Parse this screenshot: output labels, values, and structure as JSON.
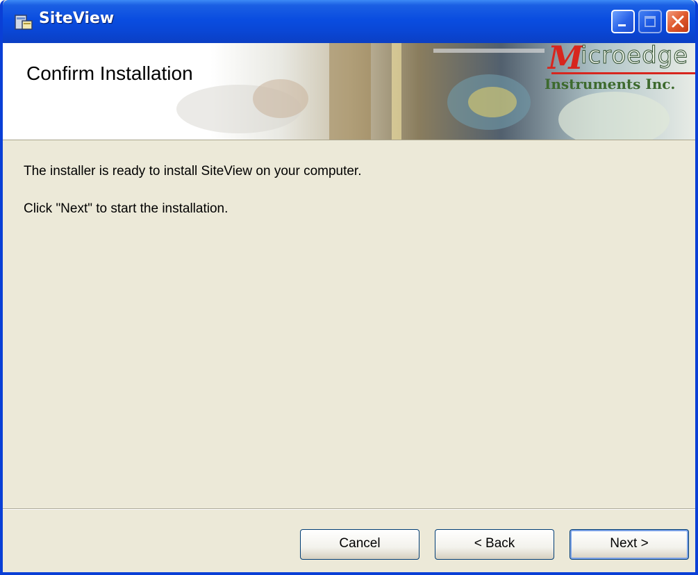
{
  "window": {
    "title": "SiteView",
    "minimize_icon": "minimize-icon",
    "maximize_icon": "maximize-icon",
    "close_icon": "close-icon",
    "app_icon": "installer-icon"
  },
  "banner": {
    "title": "Confirm Installation",
    "logo": {
      "initial": "M",
      "text": "icroedge",
      "subtext": "Instruments Inc.",
      "accent_color": "#d7261e"
    }
  },
  "content": {
    "lines": [
      "The installer is ready to install SiteView on your computer.",
      "Click \"Next\" to start the installation."
    ]
  },
  "buttons": {
    "cancel": "Cancel",
    "back": "< Back",
    "next": "Next >"
  },
  "colors": {
    "titlebar": "#0a4de0",
    "dialog_bg": "#ece9d8",
    "close_button": "#df5a2e"
  }
}
